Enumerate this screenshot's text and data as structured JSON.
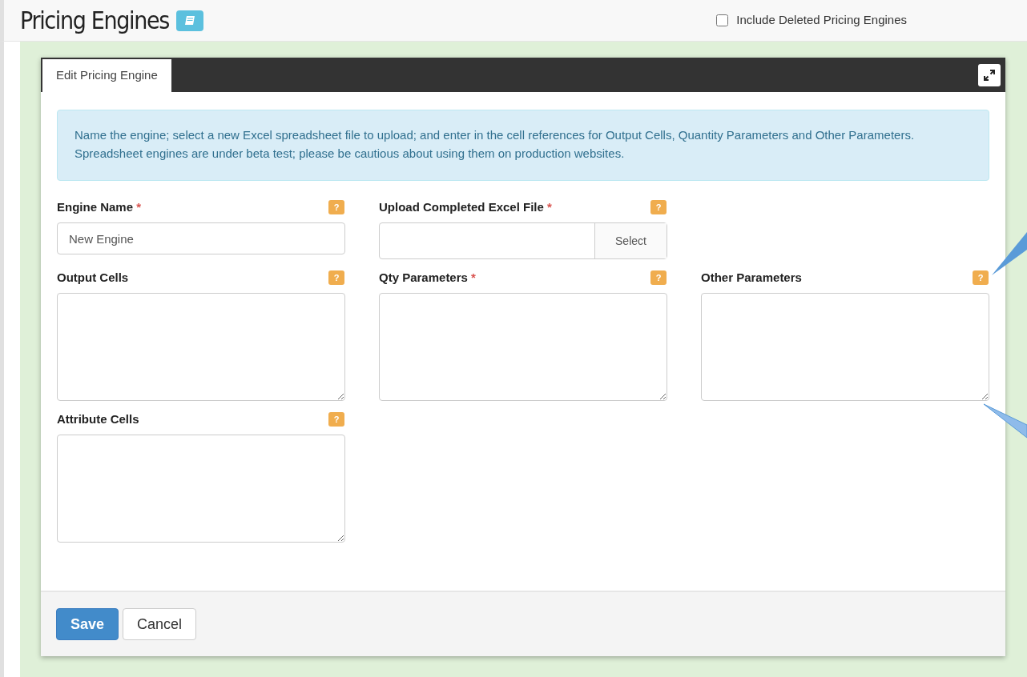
{
  "page": {
    "title": "Pricing Engines",
    "include_deleted": {
      "label": "Include Deleted Pricing Engines",
      "checked": false
    }
  },
  "panel": {
    "tabs": [
      {
        "label": "Edit Pricing Engine",
        "selected": true
      }
    ],
    "info": "Name the engine; select a new Excel spreadsheet file to upload; and enter in the cell references for Output Cells, Quantity Parameters and Other Parameters. Spreadsheet engines are under beta test; please be cautious about using them on production websites.",
    "rows": [
      [
        {
          "kind": "text",
          "label": "Engine Name",
          "required": true,
          "value": "New Engine"
        },
        {
          "kind": "file",
          "label": "Upload Completed Excel File",
          "required": true,
          "button": "Select"
        }
      ],
      [
        {
          "kind": "textarea",
          "label": "Output Cells",
          "required": false
        },
        {
          "kind": "textarea",
          "label": "Qty Parameters",
          "required": true
        },
        {
          "kind": "textarea",
          "label": "Other Parameters",
          "required": false
        }
      ],
      [
        {
          "kind": "textarea",
          "label": "Attribute Cells",
          "required": false
        }
      ]
    ],
    "help_mark": "?",
    "required_mark": "*",
    "buttons": [
      {
        "label": "Save",
        "primary": true
      },
      {
        "label": "Cancel",
        "primary": false
      }
    ]
  }
}
